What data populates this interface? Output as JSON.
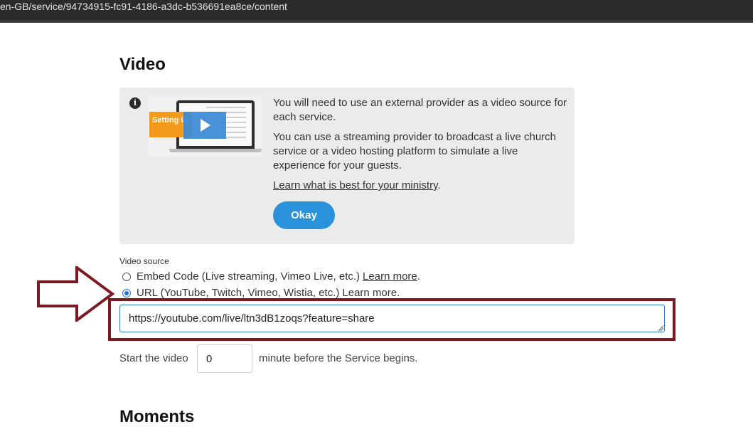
{
  "browser": {
    "url_text": "en-GB/service/94734915-fc91-4186-a3dc-b536691ea8ce/content"
  },
  "page": {
    "title": "Video",
    "next_section_title": "Moments"
  },
  "info_card": {
    "icon": "info-icon",
    "thumbnail_caption": "Setting Up Your Video",
    "paragraph_1": "You will need to use an external provider as a video source for each service.",
    "paragraph_2": "You can use a streaming provider to broadcast a live church service or a video hosting platform to simulate a live experience for your guests.",
    "link_text": "Learn what is best for your ministry",
    "link_suffix": ".",
    "button_label": "Okay"
  },
  "video_source": {
    "label": "Video source",
    "options": [
      {
        "text": "Embed Code (Live streaming, Vimeo Live, etc.)",
        "link": "Learn more",
        "suffix": ".",
        "selected": false
      },
      {
        "text": "URL (YouTube, Twitch, Vimeo, Wistia, etc.)",
        "link": "Learn more",
        "suffix": ".",
        "selected": true
      }
    ],
    "url_value": "https://youtube.com/live/ltn3dB1zoqs?feature=share"
  },
  "start": {
    "prefix": "Start the video",
    "minutes_value": "0",
    "suffix": "minute before the Service begins."
  },
  "colors": {
    "accent": "#2a92db",
    "annotation": "#7b1a22",
    "card_bg": "#ebebeb"
  }
}
